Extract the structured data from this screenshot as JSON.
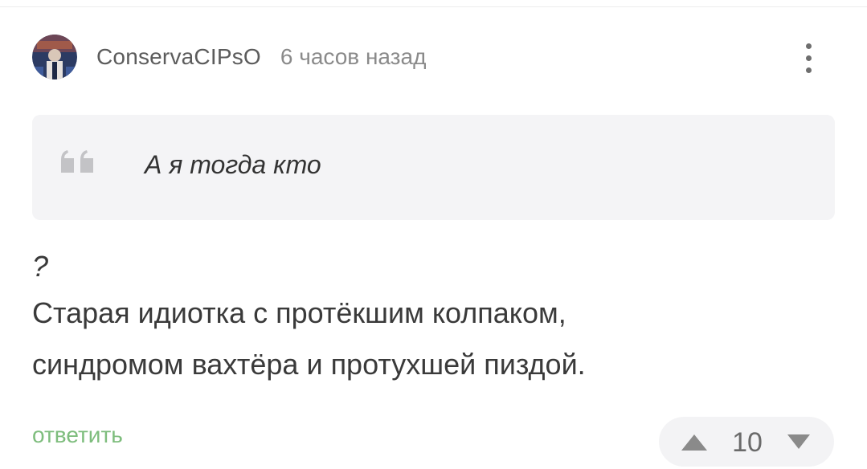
{
  "comment": {
    "author": "ConservaCIPsO",
    "timestamp": "6 часов назад",
    "avatar_icon": "user-avatar-icon",
    "menu_icon": "more-vertical-icon",
    "quote": {
      "icon": "quote-icon",
      "text": "А я тогда кто"
    },
    "body": {
      "line1": "?",
      "line2": "Старая идиотка с протёкшим колпаком,",
      "line3": "синдромом вахтёра и протухшей пиздой."
    },
    "reply_label": "ответить",
    "votes": {
      "up_icon": "triangle-up-icon",
      "count": "10",
      "down_icon": "triangle-down-icon"
    }
  },
  "colors": {
    "accent_green": "#7ebd7d",
    "quote_background": "#f4f4f6",
    "vote_background": "#f3f3f5",
    "text_primary": "#3a3a3a",
    "text_muted": "#8a8a8a"
  }
}
